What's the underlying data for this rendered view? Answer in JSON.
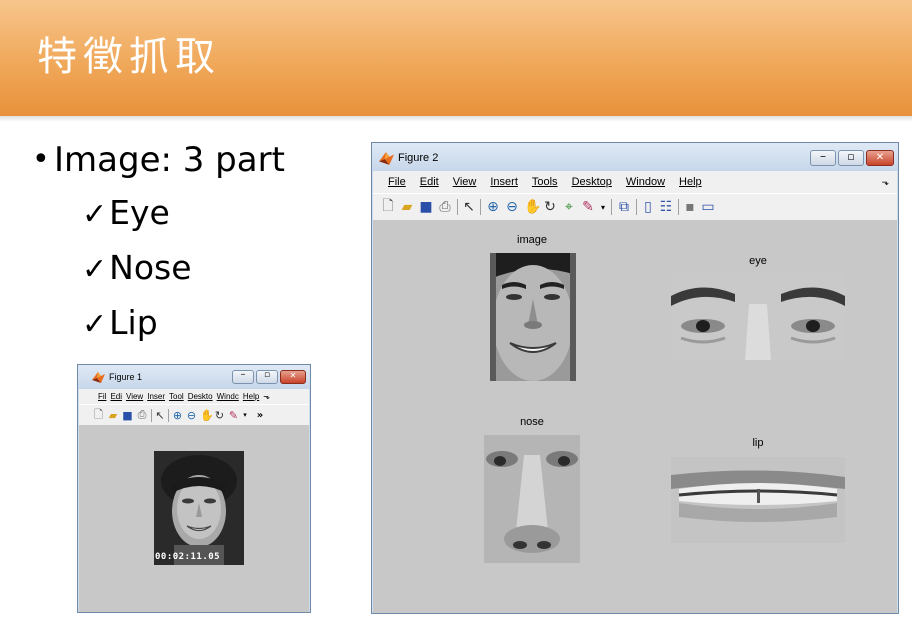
{
  "slide": {
    "title": "特徵抓取",
    "bullet_main": "Image: 3 part",
    "bullet_marker": "•",
    "check": "✓",
    "sub_items": [
      "Eye",
      "Nose",
      "Lip"
    ]
  },
  "figure1": {
    "title": "Figure 1",
    "menu": [
      "File",
      "Edit",
      "View",
      "Insert",
      "Tools",
      "Desktop",
      "Window",
      "Help"
    ],
    "menu_truncated": [
      "Fil",
      "Edi",
      "View",
      "Inser",
      "Tool",
      "Deskto",
      "Windc",
      "Help"
    ],
    "overflow_glyph": "»",
    "timestamp": "00:02:11.05",
    "min_label": "–",
    "max_label": "▫",
    "close_label": "✕"
  },
  "figure2": {
    "title": "Figure 2",
    "menu": [
      "File",
      "Edit",
      "View",
      "Insert",
      "Tools",
      "Desktop",
      "Window",
      "Help"
    ],
    "min_label": "–",
    "max_label": "▫",
    "close_label": "✕",
    "subplots": {
      "image": "image",
      "eye": "eye",
      "nose": "nose",
      "lip": "lip"
    }
  },
  "icons": {
    "toolbar": [
      "new-file-icon",
      "open-folder-icon",
      "save-icon",
      "print-icon",
      "pointer-icon",
      "zoom-in-icon",
      "zoom-out-icon",
      "pan-hand-icon",
      "rotate-3d-icon",
      "data-cursor-icon",
      "brush-icon",
      "link-plot-icon",
      "colorbar-icon",
      "legend-icon",
      "hide-plot-tools-icon",
      "show-plot-tools-icon"
    ]
  },
  "colors": {
    "title_gradient_top": "#f7c58c",
    "title_gradient_bottom": "#e8913b",
    "figure_background": "#c8c8c8",
    "close_button": "#c9432a"
  }
}
